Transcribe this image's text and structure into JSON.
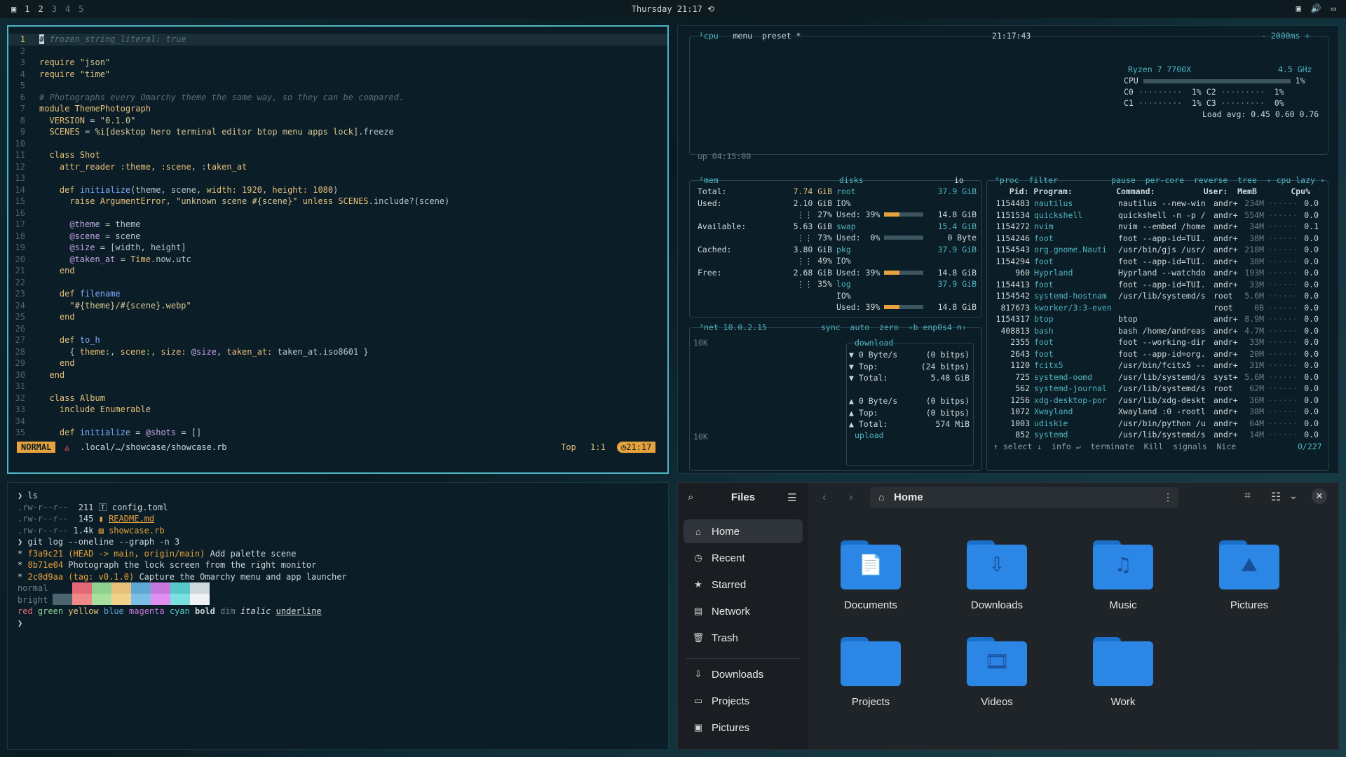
{
  "topbar": {
    "workspaces": [
      "1",
      "2",
      "3",
      "4",
      "5"
    ],
    "clock": "Thursday 21:17"
  },
  "nvim": {
    "lines": [
      {
        "n": "1",
        "html": "<span class=\"cm\"># frozen_string_literal: true</span>"
      },
      {
        "n": "2",
        "html": ""
      },
      {
        "n": "3",
        "html": "<span class=\"kw\">require</span> <span class=\"str\">\"json\"</span>"
      },
      {
        "n": "4",
        "html": "<span class=\"kw\">require</span> <span class=\"str\">\"time\"</span>"
      },
      {
        "n": "5",
        "html": ""
      },
      {
        "n": "6",
        "html": "<span class=\"cm\"># Photographs every Omarchy theme the same way, so they can be compared.</span>"
      },
      {
        "n": "7",
        "html": "<span class=\"kw\">module</span> <span class=\"cls\">ThemePhotograph</span>"
      },
      {
        "n": "8",
        "html": "  <span class=\"const\">VERSION</span> = <span class=\"str\">\"0.1.0\"</span>"
      },
      {
        "n": "9",
        "html": "  <span class=\"const\">SCENES</span> = <span class=\"str\">%i[desktop hero terminal editor btop menu apps lock]</span>.freeze"
      },
      {
        "n": "10",
        "html": ""
      },
      {
        "n": "11",
        "html": "  <span class=\"kw\">class</span> <span class=\"cls\">Shot</span>"
      },
      {
        "n": "12",
        "html": "    <span class=\"kw\">attr_reader</span> <span class=\"sym\">:theme</span>, <span class=\"sym\">:scene</span>, <span class=\"sym\">:taken_at</span>"
      },
      {
        "n": "13",
        "html": ""
      },
      {
        "n": "14",
        "html": "    <span class=\"kw\">def</span> <span class=\"fn\">initialize</span>(theme, scene, <span class=\"sym\">width:</span> <span class=\"kw\">1920</span>, <span class=\"sym\">height:</span> <span class=\"kw\">1080</span>)"
      },
      {
        "n": "15",
        "html": "      <span class=\"kw\">raise</span> <span class=\"cls\">ArgumentError</span>, <span class=\"str\">\"unknown scene #{scene}\"</span> <span class=\"kw\">unless</span> <span class=\"const\">SCENES</span>.include?(scene)"
      },
      {
        "n": "16",
        "html": ""
      },
      {
        "n": "17",
        "html": "      <span class=\"ivar\">@theme</span> = theme"
      },
      {
        "n": "18",
        "html": "      <span class=\"ivar\">@scene</span> = scene"
      },
      {
        "n": "19",
        "html": "      <span class=\"ivar\">@size</span> = [width, height]"
      },
      {
        "n": "20",
        "html": "      <span class=\"ivar\">@taken_at</span> = <span class=\"cls\">Time</span>.now.utc"
      },
      {
        "n": "21",
        "html": "    <span class=\"kw\">end</span>"
      },
      {
        "n": "22",
        "html": ""
      },
      {
        "n": "23",
        "html": "    <span class=\"kw\">def</span> <span class=\"fn\">filename</span>"
      },
      {
        "n": "24",
        "html": "      <span class=\"str\">\"#{theme}/#{scene}.webp\"</span>"
      },
      {
        "n": "25",
        "html": "    <span class=\"kw\">end</span>"
      },
      {
        "n": "26",
        "html": ""
      },
      {
        "n": "27",
        "html": "    <span class=\"kw\">def</span> <span class=\"fn\">to_h</span>"
      },
      {
        "n": "28",
        "html": "      { <span class=\"sym\">theme:</span>, <span class=\"sym\">scene:</span>, <span class=\"sym\">size:</span> <span class=\"ivar\">@size</span>, <span class=\"sym\">taken_at:</span> taken_at.iso8601 }"
      },
      {
        "n": "29",
        "html": "    <span class=\"kw\">end</span>"
      },
      {
        "n": "30",
        "html": "  <span class=\"kw\">end</span>"
      },
      {
        "n": "31",
        "html": ""
      },
      {
        "n": "32",
        "html": "  <span class=\"kw\">class</span> <span class=\"cls\">Album</span>"
      },
      {
        "n": "33",
        "html": "    <span class=\"kw\">include</span> <span class=\"cls\">Enumerable</span>"
      },
      {
        "n": "34",
        "html": ""
      },
      {
        "n": "35",
        "html": "    <span class=\"kw\">def</span> <span class=\"fn\">initialize</span> = <span class=\"ivar\">@shots</span> = []"
      }
    ],
    "status": {
      "mode": "NORMAL",
      "path": ".local/…/showcase/showcase.rb",
      "top": "Top",
      "pos": "1:1",
      "time": "21:17"
    }
  },
  "btop": {
    "cpu_header": {
      "label": "¹cpu",
      "menu": "menu",
      "preset": "preset *",
      "time": "21:17:43",
      "interval": "- 2000ms +"
    },
    "cpu_model": "Ryzen 7 7700X",
    "cpu_freq": "4.5 GHz",
    "cpu_rows": [
      {
        "label": "CPU",
        "val": "1%"
      },
      {
        "label": "C0",
        "val": "1%",
        "label2": "C2",
        "val2": "1%"
      },
      {
        "label": "C1",
        "val": "1%",
        "label2": "C3",
        "val2": "0%"
      }
    ],
    "load_avg": "Load avg: 0.45 0.60 0.76",
    "uptime": "up 04:15:00",
    "mem": {
      "label": "²mem",
      "rows": [
        {
          "k": "Total:",
          "v": "7.74 GiB"
        },
        {
          "k": "Used:",
          "v": "2.10 GiB"
        },
        {
          "k": "",
          "v": "27%"
        },
        {
          "k": "Available:",
          "v": "5.63 GiB"
        },
        {
          "k": "",
          "v": "73%"
        },
        {
          "k": "Cached:",
          "v": "3.80 GiB"
        },
        {
          "k": "",
          "v": "49%"
        },
        {
          "k": "Free:",
          "v": "2.68 GiB"
        },
        {
          "k": "",
          "v": "35%"
        }
      ]
    },
    "disks": {
      "label": "disks",
      "io": "io",
      "rows": [
        {
          "k": "root",
          "v": "37.9 GiB",
          "c": "tl"
        },
        {
          "k": "IO%",
          "v": "",
          "c": "wt"
        },
        {
          "k": "Used: 39%",
          "v": "14.8 GiB",
          "c": "wt",
          "bar": 0.39
        },
        {
          "k": "swap",
          "v": "15.4 GiB",
          "c": "tl"
        },
        {
          "k": "Used:  0%",
          "v": "0 Byte",
          "c": "wt",
          "bar": 0
        },
        {
          "k": "pkg",
          "v": "37.9 GiB",
          "c": "tl"
        },
        {
          "k": "IO%",
          "v": "",
          "c": "wt"
        },
        {
          "k": "Used: 39%",
          "v": "14.8 GiB",
          "c": "wt",
          "bar": 0.39
        },
        {
          "k": "log",
          "v": "37.9 GiB",
          "c": "tl"
        },
        {
          "k": "IO%",
          "v": "",
          "c": "wt"
        },
        {
          "k": "Used: 39%",
          "v": "14.8 GiB",
          "c": "wt",
          "bar": 0.39
        }
      ]
    },
    "net": {
      "label": "³net",
      "ip": "10.0.2.15",
      "opts": "sync  auto  zero  ‹b enp0s4 n›",
      "scale_top": "10K",
      "scale_bot": "10K",
      "download": "download",
      "upload": "upload",
      "rows": [
        {
          "k": "▼ 0 Byte/s",
          "v": "(0 bitps)"
        },
        {
          "k": "▼ Top:",
          "v": "(24 bitps)"
        },
        {
          "k": "▼ Total:",
          "v": "5.48 GiB"
        },
        {
          "k": "▲ 0 Byte/s",
          "v": "(0 bitps)"
        },
        {
          "k": "▲ Top:",
          "v": "(0 bitps)"
        },
        {
          "k": "▲ Total:",
          "v": "574 MiB"
        }
      ]
    },
    "proc": {
      "header": "⁴proc  filter           pause  per-core  reverse  tree  ‹ cpu lazy ›",
      "cols": "   Pid: Program:         Command:          User:  MemB       Cpu%",
      "rows": [
        [
          "1154483",
          "nautilus",
          "nautilus --new-win",
          "andr+",
          "234M",
          "0.0"
        ],
        [
          "1151534",
          "quickshell",
          "quickshell -n -p /",
          "andr+",
          "554M",
          "0.0"
        ],
        [
          "1154272",
          "nvim",
          "nvim --embed /home",
          "andr+",
          "34M",
          "0.1"
        ],
        [
          "1154246",
          "foot",
          "foot --app-id=TUI.",
          "andr+",
          "38M",
          "0.0"
        ],
        [
          "1154543",
          "org.gnome.Nauti",
          "/usr/bin/gjs /usr/",
          "andr+",
          "218M",
          "0.0"
        ],
        [
          "1154294",
          "foot",
          "foot --app-id=TUI.",
          "andr+",
          "38M",
          "0.0"
        ],
        [
          "960",
          "Hyprland",
          "Hyprland --watchdo",
          "andr+",
          "193M",
          "0.0"
        ],
        [
          "1154413",
          "foot",
          "foot --app-id=TUI.",
          "andr+",
          "33M",
          "0.0"
        ],
        [
          "1154542",
          "systemd-hostnam",
          "/usr/lib/systemd/s",
          "root",
          "5.6M",
          "0.0"
        ],
        [
          "817673",
          "kworker/3:3-even",
          "",
          "root",
          "0B",
          "0.0"
        ],
        [
          "1154317",
          "btop",
          "btop",
          "andr+",
          "8.9M",
          "0.0"
        ],
        [
          "408813",
          "bash",
          "bash /home/andreas",
          "andr+",
          "4.7M",
          "0.0"
        ],
        [
          "2355",
          "foot",
          "foot --working-dir",
          "andr+",
          "33M",
          "0.0"
        ],
        [
          "2643",
          "foot",
          "foot --app-id=org.",
          "andr+",
          "20M",
          "0.0"
        ],
        [
          "1120",
          "fcitx5",
          "/usr/bin/fcitx5 --",
          "andr+",
          "31M",
          "0.0"
        ],
        [
          "725",
          "systemd-oomd",
          "/usr/lib/systemd/s",
          "syst+",
          "5.6M",
          "0.0"
        ],
        [
          "562",
          "systemd-journal",
          "/usr/lib/systemd/s",
          "root",
          "62M",
          "0.0"
        ],
        [
          "1256",
          "xdg-desktop-por",
          "/usr/lib/xdg-deskt",
          "andr+",
          "36M",
          "0.0"
        ],
        [
          "1072",
          "Xwayland",
          "Xwayland :0 -rootl",
          "andr+",
          "38M",
          "0.0"
        ],
        [
          "1003",
          "udiskie",
          "/usr/bin/python /u",
          "andr+",
          "64M",
          "0.0"
        ],
        [
          "852",
          "systemd",
          "/usr/lib/systemd/s",
          "andr+",
          "14M",
          "0.0"
        ]
      ],
      "footer": "↑ select ↓  info ↵  terminate  Kill  signals  Nice",
      "count": "0/227"
    }
  },
  "term": {
    "lines": [
      {
        "html": "<span class=\"wt\">❯ ls</span>"
      },
      {
        "html": "<span class=\"dm\">.rw-r--r--</span>  <span class=\"wt\">211</span> <span class=\"wt\">🅃 config.toml</span>"
      },
      {
        "html": "<span class=\"dm\">.rw-r--r--</span>  <span class=\"wt\">145</span> <span class=\"or\">▮ <u>README.md</u></span>"
      },
      {
        "html": "<span class=\"dm\">.rw-r--r--</span> <span class=\"wt\">1.4k</span> <span class=\"or\">▨ showcase.rb</span>"
      },
      {
        "html": "<span class=\"wt\">❯ git log --oneline --graph -n 3</span>"
      },
      {
        "html": "<span class=\"wt\">*</span> <span class=\"or\">f3a9c21</span> <span class=\"or\">(HEAD -&gt; main, origin/main)</span> <span class=\"wt\">Add palette scene</span>"
      },
      {
        "html": "<span class=\"wt\">*</span> <span class=\"or\">8b71e04</span> <span class=\"wt\">Photograph the lock screen from the right monitor</span>"
      },
      {
        "html": "<span class=\"wt\">*</span> <span class=\"or\">2c0d9aa</span> <span class=\"or\">(tag: v0.1.0)</span> <span class=\"wt\">Capture the Omarchy menu and app launcher</span>"
      },
      {
        "html": "<span class=\"dm\">normal</span>"
      },
      {
        "html": "<span class=\"dm\">bright</span>"
      },
      {
        "html": "<span style=\"color:#e46876\">red</span> <span style=\"color:#8fd18f\">green</span> <span style=\"color:#e6c07b\">yellow</span> <span style=\"color:#5fa8d3\">blue</span> <span style=\"color:#c678dd\">magenta</span> <span style=\"color:#56c8c8\">cyan</span> <b class=\"wt\">bold</b> <span class=\"dm\">dim</span> <i class=\"wt\">italic</i> <u class=\"wt\">underline</u>"
      },
      {
        "html": "<span class=\"wt\">❯</span>"
      }
    ],
    "palette_normal": [
      "#0b1d26",
      "#e46876",
      "#8fd18f",
      "#e6c07b",
      "#5fa8d3",
      "#c678dd",
      "#56c8c8",
      "#cfd8dc"
    ],
    "palette_bright": [
      "#4c6470",
      "#f08a8a",
      "#a8e0a0",
      "#f2d28a",
      "#7cbfe6",
      "#e08ff0",
      "#7ae0e0",
      "#eef2f4"
    ]
  },
  "files": {
    "title": "Files",
    "location": "Home",
    "sidebar": [
      {
        "label": "Home",
        "icon": "⌂",
        "name": "home"
      },
      {
        "label": "Recent",
        "icon": "◷",
        "name": "recent"
      },
      {
        "label": "Starred",
        "icon": "★",
        "name": "starred"
      },
      {
        "label": "Network",
        "icon": "▤",
        "name": "network"
      },
      {
        "label": "Trash",
        "icon": "🗑",
        "name": "trash"
      },
      {
        "label": "Downloads",
        "icon": "⇩",
        "name": "downloads"
      },
      {
        "label": "Projects",
        "icon": "▭",
        "name": "projects"
      },
      {
        "label": "Pictures",
        "icon": "▣",
        "name": "pictures"
      }
    ],
    "folders": [
      {
        "label": "Documents",
        "glyph": "📄",
        "name": "documents"
      },
      {
        "label": "Downloads",
        "glyph": "⇩",
        "name": "downloads"
      },
      {
        "label": "Music",
        "glyph": "♫",
        "name": "music"
      },
      {
        "label": "Pictures",
        "glyph": "⛰",
        "name": "pictures"
      },
      {
        "label": "Projects",
        "glyph": "",
        "name": "projects"
      },
      {
        "label": "Videos",
        "glyph": "🎞",
        "name": "videos"
      },
      {
        "label": "Work",
        "glyph": "",
        "name": "work"
      }
    ]
  }
}
